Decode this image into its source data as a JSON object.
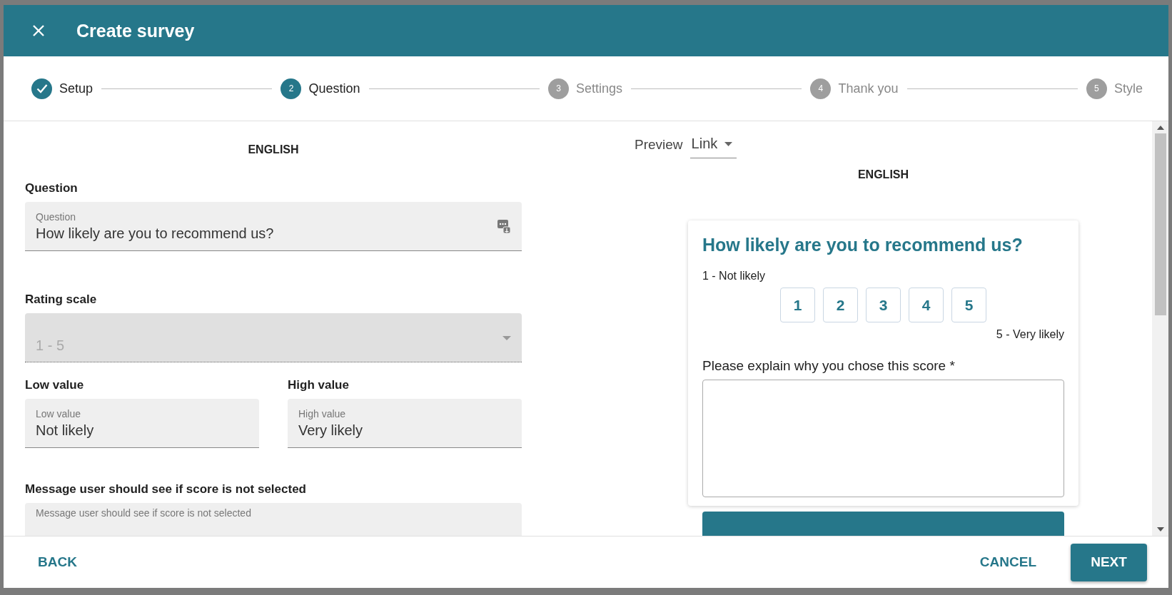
{
  "dialog": {
    "title": "Create survey"
  },
  "steps": [
    {
      "label": "Setup",
      "completed": true,
      "active": true
    },
    {
      "number": "2",
      "label": "Question",
      "completed": false,
      "active": true
    },
    {
      "number": "3",
      "label": "Settings",
      "completed": false,
      "active": false
    },
    {
      "number": "4",
      "label": "Thank you",
      "completed": false,
      "active": false
    },
    {
      "number": "5",
      "label": "Style",
      "completed": false,
      "active": false
    }
  ],
  "editor": {
    "language": "ENGLISH",
    "question": {
      "heading": "Question",
      "label": "Question",
      "value": "How likely are you to recommend us?"
    },
    "rating_scale": {
      "heading": "Rating scale",
      "value": "1 - 5",
      "disabled": true
    },
    "low_value": {
      "heading": "Low value",
      "label": "Low value",
      "value": "Not likely"
    },
    "high_value": {
      "heading": "High value",
      "label": "High value",
      "value": "Very likely"
    },
    "message": {
      "heading": "Message user should see if score is not selected",
      "label": "Message user should see if score is not selected"
    }
  },
  "preview": {
    "label": "Preview",
    "mode": "Link",
    "language": "ENGLISH",
    "question": "How likely are you to recommend us?",
    "low_label": "1 - Not likely",
    "scores": [
      "1",
      "2",
      "3",
      "4",
      "5"
    ],
    "high_label": "5 - Very likely",
    "comment_label": "Please explain why you chose this score *"
  },
  "footer": {
    "back": "BACK",
    "cancel": "CANCEL",
    "next": "NEXT"
  }
}
